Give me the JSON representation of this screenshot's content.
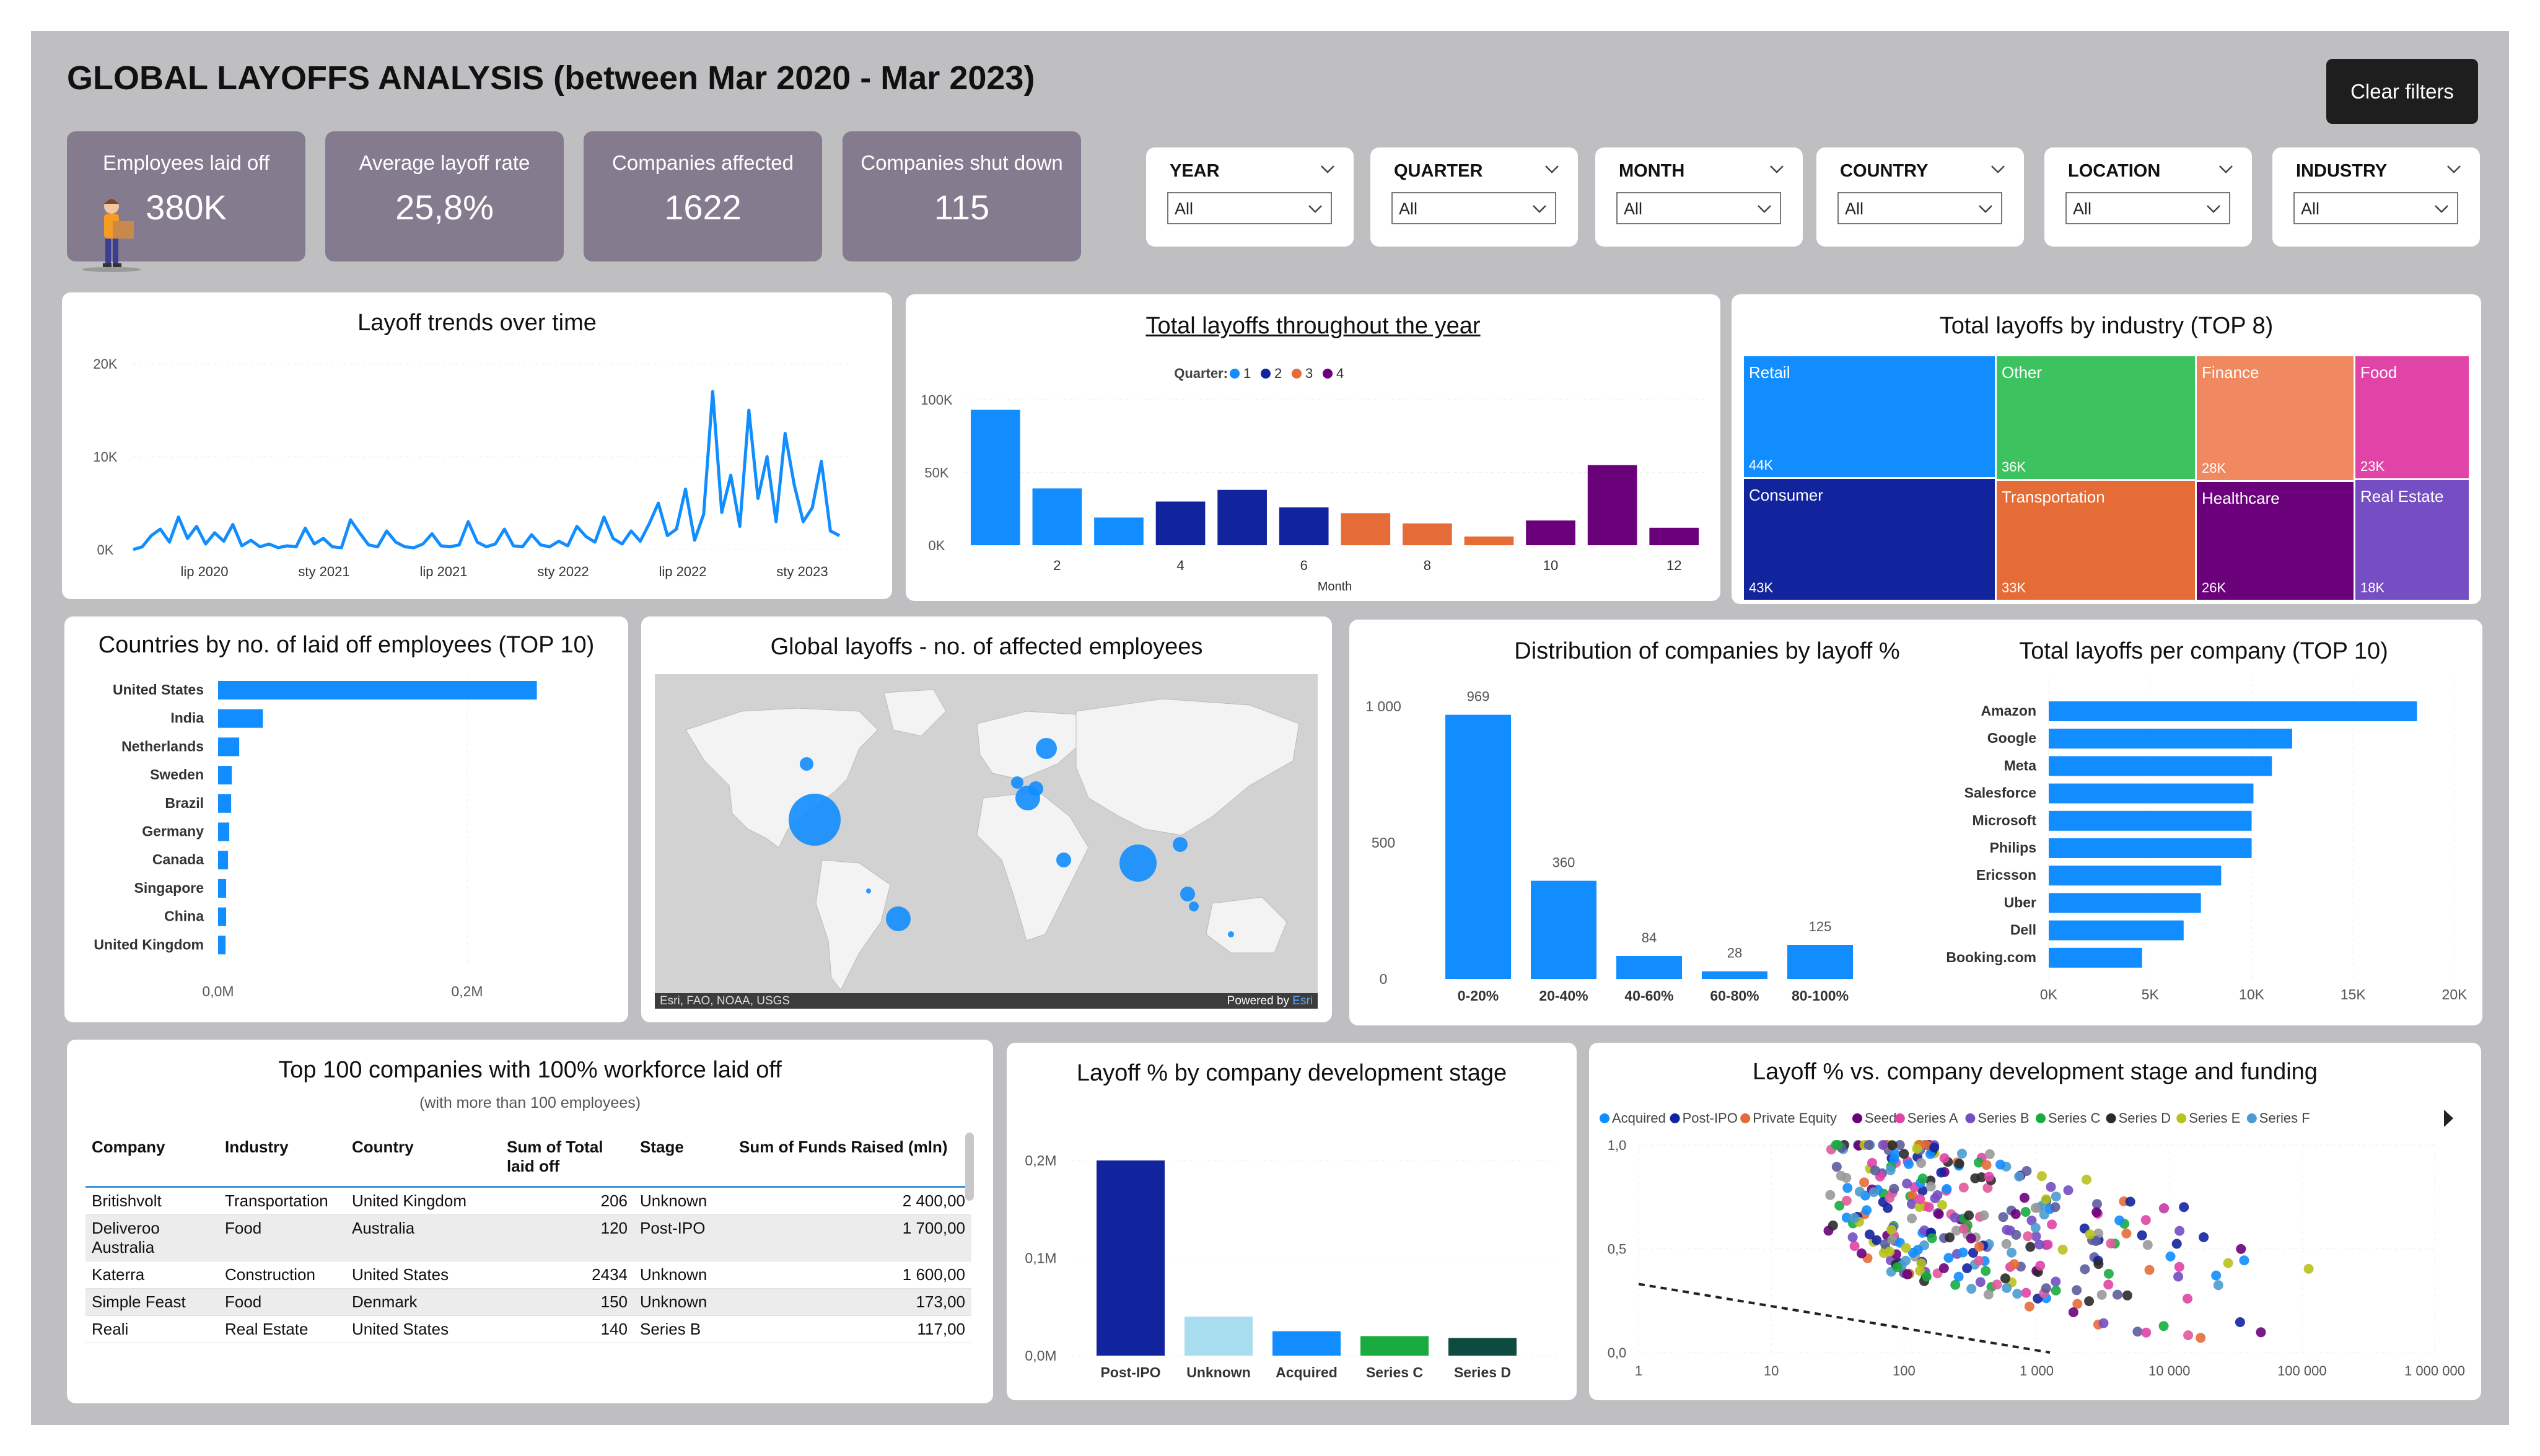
{
  "header": {
    "title": "GLOBAL LAYOFFS ANALYSIS (between Mar 2020 - Mar 2023)",
    "clear_label": "Clear filters"
  },
  "kpis": [
    {
      "label": "Employees laid off",
      "value": "380K"
    },
    {
      "label": "Average layoff rate",
      "value": "25,8%"
    },
    {
      "label": "Companies affected",
      "value": "1622"
    },
    {
      "label": "Companies shut down",
      "value": "115"
    }
  ],
  "slicers": [
    {
      "title": "YEAR",
      "value": "All"
    },
    {
      "title": "QUARTER",
      "value": "All"
    },
    {
      "title": "MONTH",
      "value": "All"
    },
    {
      "title": "COUNTRY",
      "value": "All"
    },
    {
      "title": "LOCATION",
      "value": "All"
    },
    {
      "title": "INDUSTRY",
      "value": "All"
    }
  ],
  "colors": {
    "blue": "#118dff",
    "navy": "#12239e",
    "orange": "#e66c37",
    "purple": "#6b007b",
    "kpi_bg": "#857b8f"
  },
  "map": {
    "title": "Global layoffs - no. of affected employees",
    "attribution": "Esri, FAO, NOAA, USGS",
    "powered_prefix": "Powered by ",
    "powered_brand": "Esri"
  },
  "table": {
    "title": "Top 100 companies with 100% workforce laid off",
    "subtitle": "(with more than 100 employees)",
    "columns": [
      "Company",
      "Industry",
      "Country",
      "Sum of Total laid off",
      "Stage",
      "Sum of Funds Raised (mln)"
    ],
    "rows": [
      [
        "Britishvolt",
        "Transportation",
        "United Kingdom",
        "206",
        "Unknown",
        "2 400,00"
      ],
      [
        "Deliveroo Australia",
        "Food",
        "Australia",
        "120",
        "Post-IPO",
        "1 700,00"
      ],
      [
        "Katerra",
        "Construction",
        "United States",
        "2434",
        "Unknown",
        "1 600,00"
      ],
      [
        "Simple Feast",
        "Food",
        "Denmark",
        "150",
        "Unknown",
        "173,00"
      ],
      [
        "Reali",
        "Real Estate",
        "United States",
        "140",
        "Series B",
        "117,00"
      ]
    ]
  },
  "chart_data": [
    {
      "type": "line",
      "title": "Layoff trends over time",
      "ylim": [
        0,
        20000
      ],
      "yticks": [
        "0K",
        "10K",
        "20K"
      ],
      "xticks": [
        "lip 2020",
        "sty 2021",
        "lip 2021",
        "sty 2022",
        "lip 2022",
        "sty 2023"
      ],
      "series": [
        {
          "values": [
            0,
            300,
            1500,
            2200,
            800,
            3500,
            1200,
            2500,
            600,
            1800,
            900,
            2700,
            400,
            1000,
            300,
            600,
            200,
            400,
            300,
            2300,
            600,
            1200,
            300,
            200,
            3200,
            1800,
            500,
            300,
            2000,
            800,
            300,
            200,
            600,
            1700,
            400,
            300,
            500,
            3000,
            800,
            300,
            600,
            2200,
            400,
            300,
            1600,
            500,
            300,
            900,
            400,
            2500,
            1400,
            800,
            3500,
            1200,
            600,
            2000,
            900,
            2800,
            5000,
            1500,
            2200,
            6500,
            1000,
            3800,
            17000,
            4000,
            8000,
            2500,
            15000,
            5500,
            10000,
            3000,
            12500,
            7000,
            3000,
            4500,
            9500,
            2000,
            1500
          ]
        }
      ]
    },
    {
      "type": "bar",
      "title": "Total layoffs throughout the year",
      "legend_title": "Quarter:",
      "legend": [
        "1",
        "2",
        "3",
        "4"
      ],
      "xlabel": "Month",
      "categories": [
        "1",
        "2",
        "3",
        "4",
        "5",
        "6",
        "7",
        "8",
        "9",
        "10",
        "11",
        "12"
      ],
      "xticks": [
        "2",
        "4",
        "6",
        "8",
        "10",
        "12"
      ],
      "yticks": [
        "0K",
        "50K",
        "100K"
      ],
      "ylim": [
        0,
        100000
      ],
      "values": [
        93000,
        39000,
        19000,
        30000,
        38000,
        26000,
        22000,
        15000,
        6000,
        17000,
        55000,
        12000
      ],
      "quarters": [
        1,
        1,
        1,
        2,
        2,
        2,
        3,
        3,
        3,
        4,
        4,
        4
      ]
    },
    {
      "type": "treemap",
      "title": "Total layoffs by industry (TOP 8)",
      "items": [
        {
          "name": "Retail",
          "value": "44K",
          "color": "#118dff"
        },
        {
          "name": "Consumer",
          "value": "43K",
          "color": "#12239e"
        },
        {
          "name": "Other",
          "value": "36K",
          "color": "#3cc35f"
        },
        {
          "name": "Transportation",
          "value": "33K",
          "color": "#e66c37"
        },
        {
          "name": "Finance",
          "value": "28K",
          "color": "#f0895f"
        },
        {
          "name": "Healthcare",
          "value": "26K",
          "color": "#6b007b"
        },
        {
          "name": "Food",
          "value": "23K",
          "color": "#e044a7"
        },
        {
          "name": "Real Estate",
          "value": "18K",
          "color": "#744ec2"
        }
      ]
    },
    {
      "type": "bar",
      "orientation": "horizontal",
      "title": "Countries by no. of laid off employees (TOP 10)",
      "categories": [
        "United States",
        "India",
        "Netherlands",
        "Sweden",
        "Brazil",
        "Germany",
        "Canada",
        "Singapore",
        "China",
        "United Kingdom"
      ],
      "values": [
        256000,
        36000,
        17000,
        11000,
        10500,
        9000,
        8000,
        6500,
        6500,
        6000
      ],
      "xticks": [
        "0,0M",
        "0,2M"
      ],
      "xlim": [
        0,
        200000
      ]
    },
    {
      "type": "bar",
      "title": "Distribution of companies by layoff %",
      "categories": [
        "0-20%",
        "20-40%",
        "40-60%",
        "60-80%",
        "80-100%"
      ],
      "values": [
        969,
        360,
        84,
        28,
        125
      ],
      "yticks": [
        "0",
        "500",
        "1 000"
      ],
      "ylim": [
        0,
        1000
      ]
    },
    {
      "type": "bar",
      "orientation": "horizontal",
      "title": "Total layoffs per company (TOP 10)",
      "categories": [
        "Amazon",
        "Google",
        "Meta",
        "Salesforce",
        "Microsoft",
        "Philips",
        "Ericsson",
        "Uber",
        "Dell",
        "Booking.com"
      ],
      "values": [
        18150,
        12000,
        11000,
        10090,
        10000,
        10000,
        8500,
        7500,
        6650,
        4600
      ],
      "xticks": [
        "0K",
        "5K",
        "10K",
        "15K",
        "20K"
      ],
      "xlim": [
        0,
        20000
      ]
    },
    {
      "type": "bar",
      "title": "Layoff % by company development stage",
      "categories": [
        "Post-IPO",
        "Unknown",
        "Acquired",
        "Series C",
        "Series D"
      ],
      "values": [
        0.2,
        0.04,
        0.025,
        0.02,
        0.018
      ],
      "colors": [
        "#12239e",
        "#a8ddf0",
        "#118dff",
        "#1aab40",
        "#0d4a3f"
      ],
      "yticks": [
        "0,0M",
        "0,1M",
        "0,2M"
      ],
      "ylim": [
        0,
        0.2
      ]
    },
    {
      "type": "scatter",
      "title": "Layoff % vs. company development stage and funding",
      "legend": [
        {
          "name": "Acquired",
          "color": "#118dff"
        },
        {
          "name": "Post-IPO",
          "color": "#12239e"
        },
        {
          "name": "Private Equity",
          "color": "#e66c37"
        },
        {
          "name": "Seed",
          "color": "#6b007b"
        },
        {
          "name": "Series A",
          "color": "#e044a7"
        },
        {
          "name": "Series B",
          "color": "#744ec2"
        },
        {
          "name": "Series C",
          "color": "#1aab40"
        },
        {
          "name": "Series D",
          "color": "#2b2b2b"
        },
        {
          "name": "Series E",
          "color": "#b8c21c"
        },
        {
          "name": "Series F",
          "color": "#4a9bcf"
        }
      ],
      "x_scale": "log",
      "xlim": [
        1,
        1000000
      ],
      "ylim": [
        0,
        1
      ],
      "xticks": [
        "1",
        "10",
        "100",
        "1 000",
        "10 000",
        "100 000",
        "1 000 000"
      ],
      "yticks": [
        "0,0",
        "0,5",
        "1,0"
      ],
      "trendline": true
    }
  ]
}
